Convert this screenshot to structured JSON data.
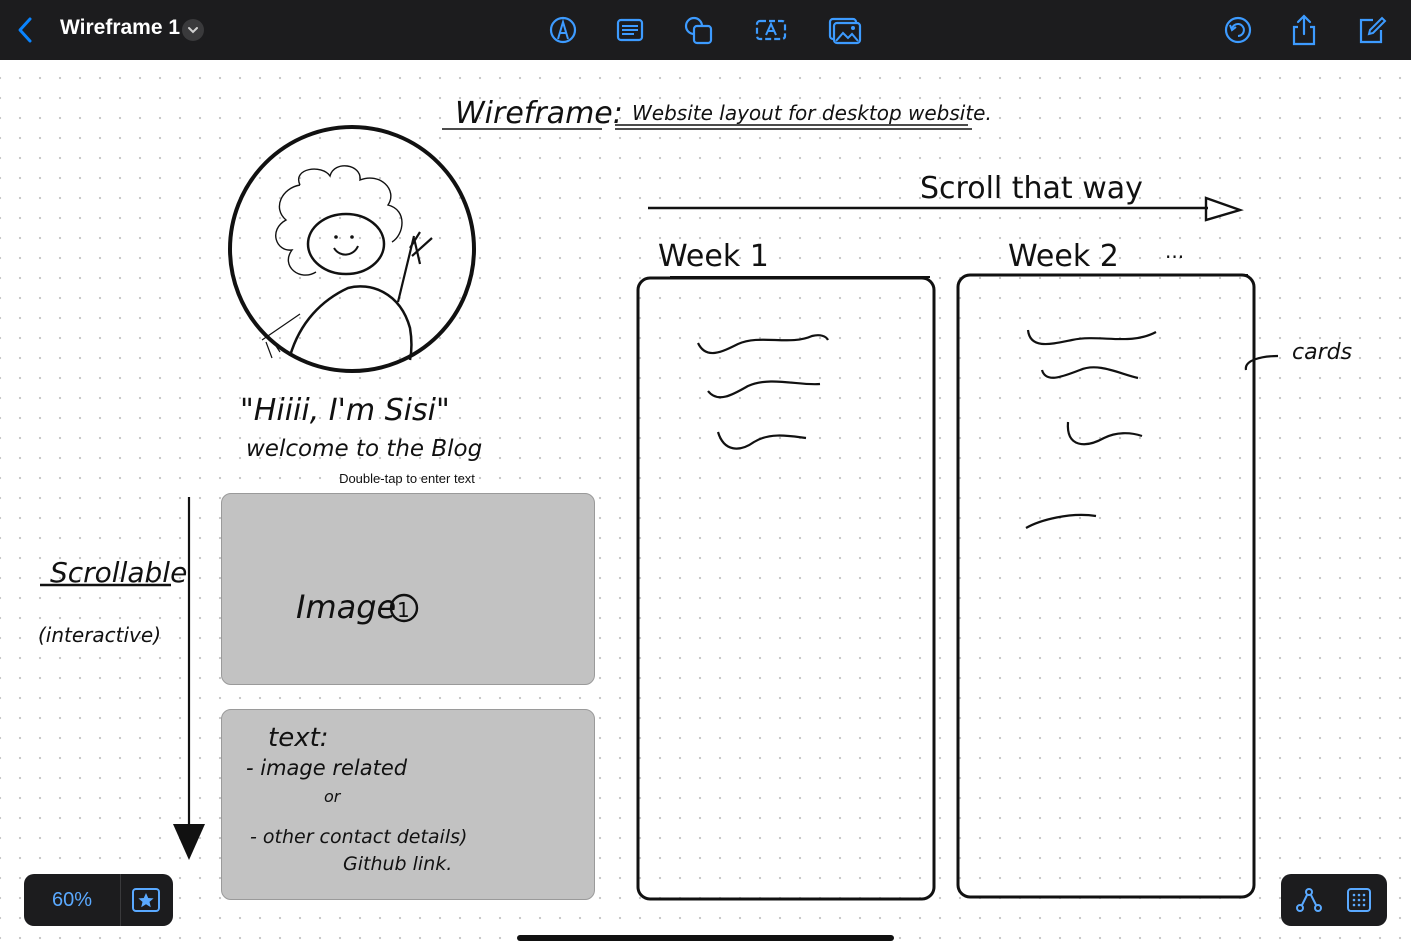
{
  "toolbar": {
    "title": "Wireframe 1",
    "icons": [
      "back-chevron",
      "pen-icon",
      "text-box-icon",
      "shapes-icon",
      "text-insert-icon",
      "media-icon",
      "undo-icon",
      "share-icon",
      "compose-icon"
    ]
  },
  "canvas": {
    "heading_left": "Wireframe:",
    "heading_right": "Website layout for desktop website.",
    "scroll_label": "Scroll that way",
    "week1": "Week 1",
    "week2": "Week 2",
    "ellipsis": "...",
    "cards_label": "cards",
    "greeting_line1": "\"Hiiii, I'm Sisi\"",
    "greeting_line2": "welcome to the Blog",
    "hint": "Double-tap to enter text",
    "scrollable_label": "Scrollable",
    "interactive_label": "(interactive)",
    "image_card_label": "Image",
    "image_card_number": "1",
    "text_card": {
      "title": "text:",
      "line1": "- image related",
      "line2": "or",
      "line3": "- other contact details)",
      "line4": "Github link."
    }
  },
  "bottom": {
    "zoom": "60%",
    "accent": "#5aa9ff"
  }
}
